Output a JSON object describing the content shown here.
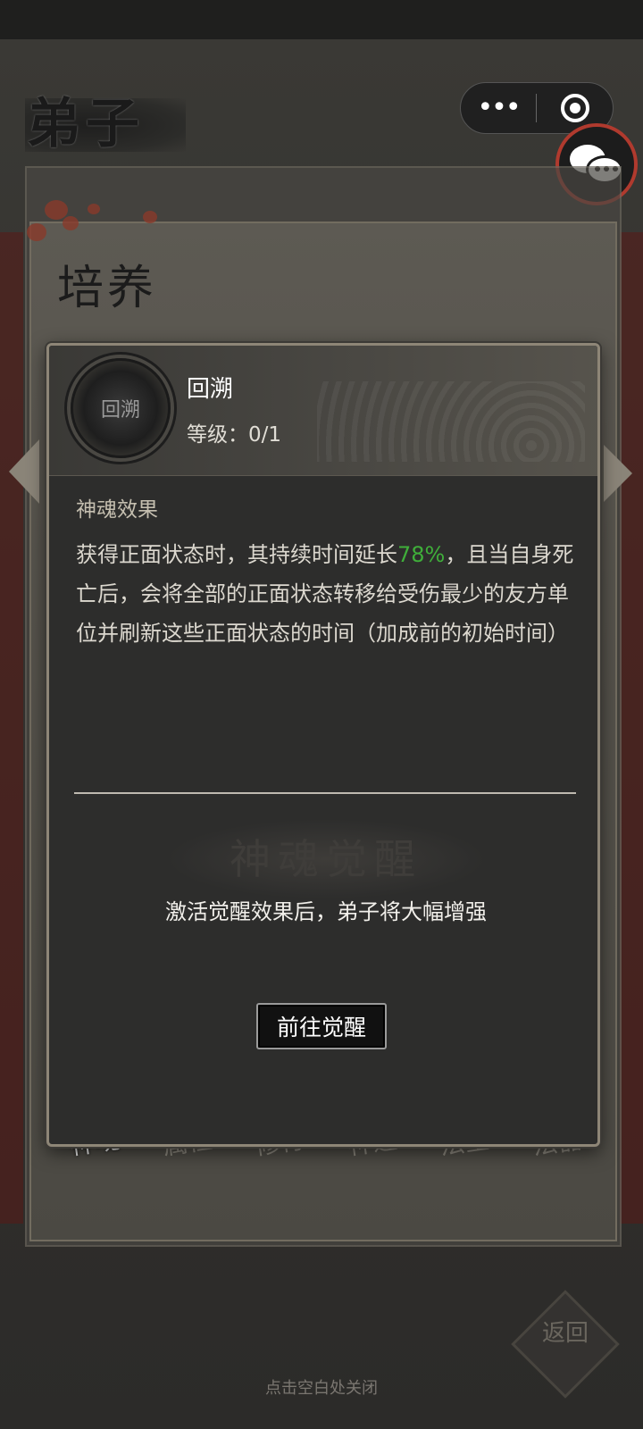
{
  "app": {
    "title": "弟子"
  },
  "miniprogram_capsule": {
    "menu_icon": "more-dots-icon",
    "close_icon": "target-circle-icon"
  },
  "chat": {
    "icon": "chat-bubbles-icon",
    "border_color": "#b03a2e"
  },
  "cultivation_panel": {
    "title": "培养",
    "tabs": [
      {
        "label": "神魂",
        "active": true
      },
      {
        "label": "属性",
        "active": false
      },
      {
        "label": "修行",
        "active": false
      },
      {
        "label": "神通",
        "active": false
      },
      {
        "label": "法宝",
        "active": false
      },
      {
        "label": "法器",
        "active": false
      }
    ]
  },
  "skill_popup": {
    "icon_label": "回溯",
    "name": "回溯",
    "level_text": "等级：0/1",
    "section_label": "神魂效果",
    "description_before": "获得正面状态时，其持续时间延长",
    "highlight_value": "78%",
    "description_after": "，且当自身死亡后，会将全部的正面状态转移给受伤最少的友方单位并刷新这些正面状态的时间（加成前的初始时间）",
    "background_heading": "神魂觉醒",
    "awaken_note": "激活觉醒效果后，弟子将大幅增强",
    "goto_button": "前往觉醒"
  },
  "return_button": "返回",
  "close_hint": "点击空白处关闭",
  "colors": {
    "highlight": "#3fae3a",
    "panel_border": "#8e8677",
    "background": "#2a2a28"
  }
}
